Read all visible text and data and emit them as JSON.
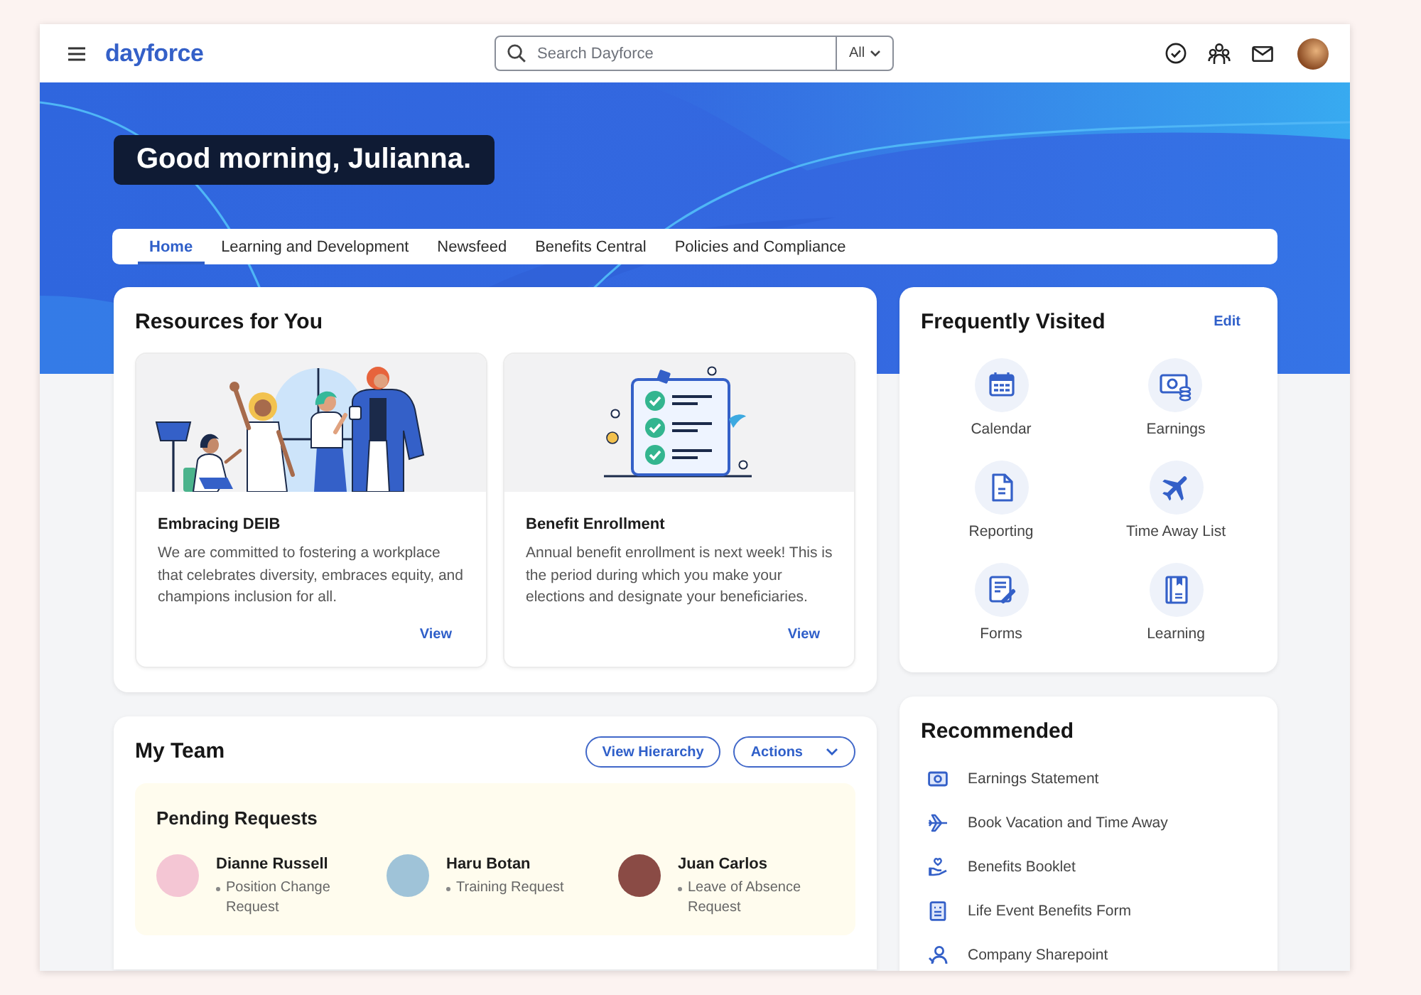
{
  "header": {
    "logo": "dayforce",
    "search": {
      "placeholder": "Search Dayforce",
      "scope": "All"
    }
  },
  "hero": {
    "greeting": "Good morning, Julianna."
  },
  "tabs": [
    {
      "label": "Home",
      "selected": true
    },
    {
      "label": "Learning and Development",
      "selected": false
    },
    {
      "label": "Newsfeed",
      "selected": false
    },
    {
      "label": "Benefits Central",
      "selected": false
    },
    {
      "label": "Policies and Compliance",
      "selected": false
    }
  ],
  "resources": {
    "title": "Resources for You",
    "cards": [
      {
        "title": "Embracing DEIB",
        "text": "We are committed to fostering a workplace that celebrates diversity, embraces equity, and champions inclusion for all.",
        "link": "View"
      },
      {
        "title": "Benefit Enrollment",
        "text": "Annual benefit enrollment is next week! This is the period during which you make your elections and designate your beneficiaries.",
        "link": "View"
      }
    ]
  },
  "frequently_visited": {
    "title": "Frequently Visited",
    "action": "Edit",
    "items": [
      "Calendar",
      "Earnings",
      "Reporting",
      "Time Away List",
      "Forms",
      "Learning"
    ]
  },
  "my_team": {
    "title": "My Team",
    "buttons": [
      "View Hierarchy",
      "Actions"
    ],
    "pending_requests": {
      "title": "Pending Requests",
      "people": [
        {
          "name": "Dianne Russell",
          "request": "Position Change Request"
        },
        {
          "name": "Haru Botan",
          "request": "Training Request"
        },
        {
          "name": "Juan Carlos",
          "request": "Leave of Absence Request"
        }
      ]
    }
  },
  "recommended": {
    "title": "Recommended",
    "items": [
      "Earnings Statement",
      "Book Vacation and Time Away",
      "Benefits Booklet",
      "Life Event Benefits Form",
      "Company Sharepoint"
    ]
  }
}
